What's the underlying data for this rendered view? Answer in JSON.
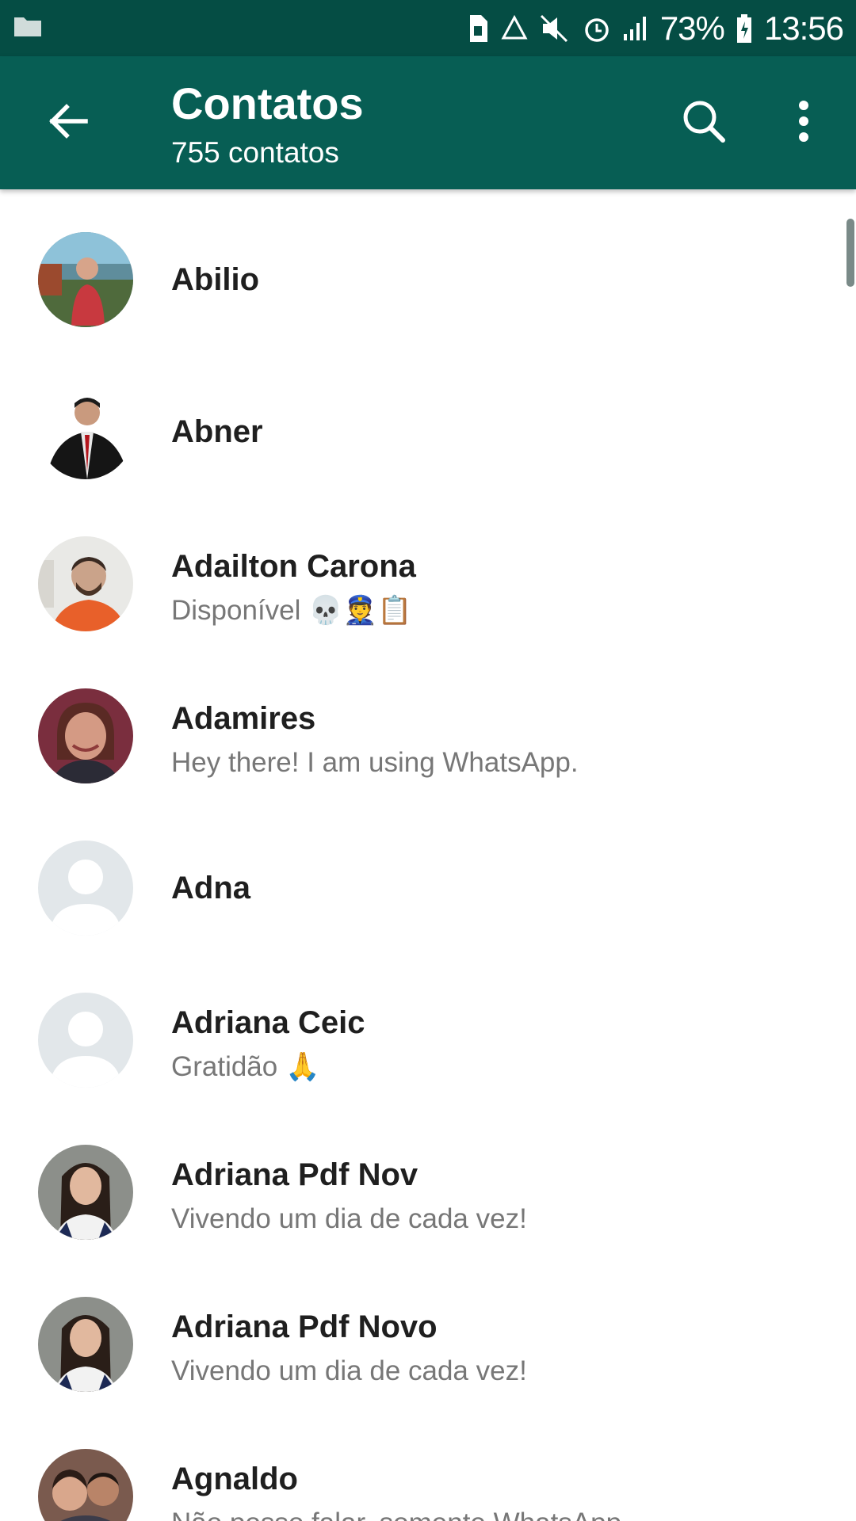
{
  "status_bar": {
    "left_icon": "folder-icon",
    "icons": [
      "sd-card-icon",
      "recycle-icon",
      "mute-vibrate-icon",
      "alarm-icon",
      "signal-icon"
    ],
    "battery": "73%",
    "time": "13:56"
  },
  "header": {
    "title": "Contatos",
    "subtitle": "755 contatos",
    "back_icon": "back-arrow-icon",
    "search_icon": "search-icon",
    "menu_icon": "more-vert-icon"
  },
  "colors": {
    "status_bar": "#054d44",
    "app_bar": "#075e54",
    "name_text": "#1f1f1f",
    "status_text": "#777777",
    "default_avatar_bg": "#e2e7ea"
  },
  "contacts": [
    {
      "name": "Abilio",
      "status": "",
      "avatar": "photo"
    },
    {
      "name": "Abner",
      "status": "",
      "avatar": "photo"
    },
    {
      "name": "Adailton Carona",
      "status": "Disponível 💀👮📋",
      "avatar": "photo"
    },
    {
      "name": "Adamires",
      "status": "Hey there! I am using WhatsApp.",
      "avatar": "photo"
    },
    {
      "name": "Adna",
      "status": "",
      "avatar": "default"
    },
    {
      "name": "Adriana Ceic",
      "status": "Gratidão 🙏",
      "avatar": "default"
    },
    {
      "name": "Adriana Pdf Nov",
      "status": "Vivendo um dia de cada vez!",
      "avatar": "photo"
    },
    {
      "name": "Adriana Pdf Novo",
      "status": "Vivendo um dia de cada vez!",
      "avatar": "photo"
    },
    {
      "name": "Agnaldo",
      "status": "Não posso falar, somente WhatsApp",
      "avatar": "photo"
    }
  ]
}
